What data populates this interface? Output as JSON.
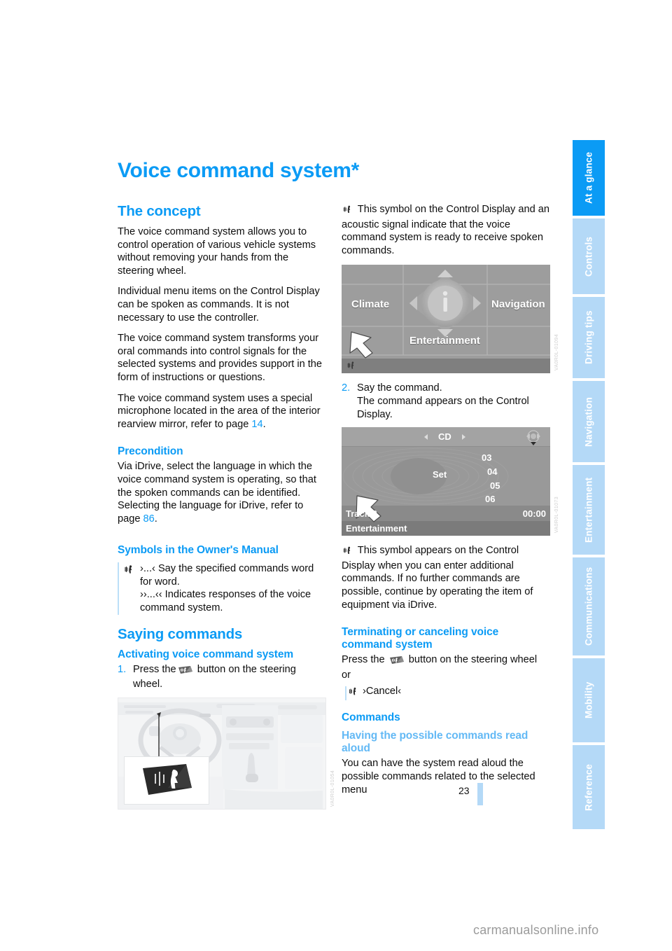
{
  "page": {
    "title": "Voice command system*",
    "number": "23",
    "watermark": "carmanualsonline.info"
  },
  "tabs": [
    {
      "label": "At a glance",
      "active": true
    },
    {
      "label": "Controls",
      "active": false
    },
    {
      "label": "Driving tips",
      "active": false
    },
    {
      "label": "Navigation",
      "active": false
    },
    {
      "label": "Entertainment",
      "active": false
    },
    {
      "label": "Communications",
      "active": false
    },
    {
      "label": "Mobility",
      "active": false
    },
    {
      "label": "Reference",
      "active": false
    }
  ],
  "left_column": {
    "concept_heading": "The concept",
    "concept_p1": "The voice command system allows you to control operation of various vehicle systems without removing your hands from the steering wheel.",
    "concept_p2": "Individual menu items on the Control Display can be spoken as commands. It is not necessary to use the controller.",
    "concept_p3": "The voice command system transforms your oral commands into control signals for the selected systems and provides support in the form of instructions or questions.",
    "concept_p4_a": "The voice command system uses a special microphone located in the area of the interior rearview mirror, refer to page",
    "concept_p4_ref": "14",
    "concept_p4_b": ".",
    "precondition_heading": "Precondition",
    "precondition_a": "Via iDrive, select the language in which the voice command system is operating, so that the spoken commands can be identified. Selecting the language for iDrive, refer to page",
    "precondition_ref": "86",
    "precondition_b": ".",
    "symbols_heading": "Symbols in the Owner's Manual",
    "symbols_line1": "›...‹ Say the specified commands word for word.",
    "symbols_line2": "››...‹‹ Indicates responses of the voice command system.",
    "saying_heading": "Saying commands",
    "activating_heading": "Activating voice command system",
    "step1_num": "1.",
    "step1_text_a": "Press the",
    "step1_text_b": "button on the steering wheel.",
    "figure_wheel_code": "VA0R0L-01054"
  },
  "right_column": {
    "symbol_ready_text": "This symbol on the Control Display and an acoustic signal indicate that the voice command system is ready to receive spoken commands.",
    "idrive_figure": {
      "code": "VA0R0L-01094",
      "labels": [
        "Climate",
        "Navigation",
        "Entertainment"
      ],
      "center_icon": "info-icon"
    },
    "step2_num": "2.",
    "step2_line1": "Say the command.",
    "step2_line2": "The command appears on the Control Display.",
    "cd_figure": {
      "code": "VA0R0L-01073",
      "header": "CD",
      "set_label": "Set",
      "track_numbers": [
        "03",
        "04",
        "05",
        "06"
      ],
      "track_label": "Track 2",
      "time": "00:00",
      "footer": "Entertainment"
    },
    "symbol_additional_text": "This symbol appears on the Control Display when you can enter additional commands. If no further commands are possible, continue by operating the item of equipment via iDrive.",
    "terminating_heading": "Terminating or canceling voice command system",
    "terminating_text_a": "Press the",
    "terminating_text_b": "button on the steering wheel",
    "terminating_or": "or",
    "cancel_command": "›Cancel‹",
    "commands_heading": "Commands",
    "read_aloud_heading": "Having the possible commands read aloud",
    "read_aloud_text": "You can have the system read aloud the possible commands related to the selected menu"
  },
  "colors": {
    "accent": "#0b9bf5",
    "tab_inactive": "#b4d9f7",
    "heading_light": "#63b9f5",
    "text": "#0d0d0d"
  }
}
